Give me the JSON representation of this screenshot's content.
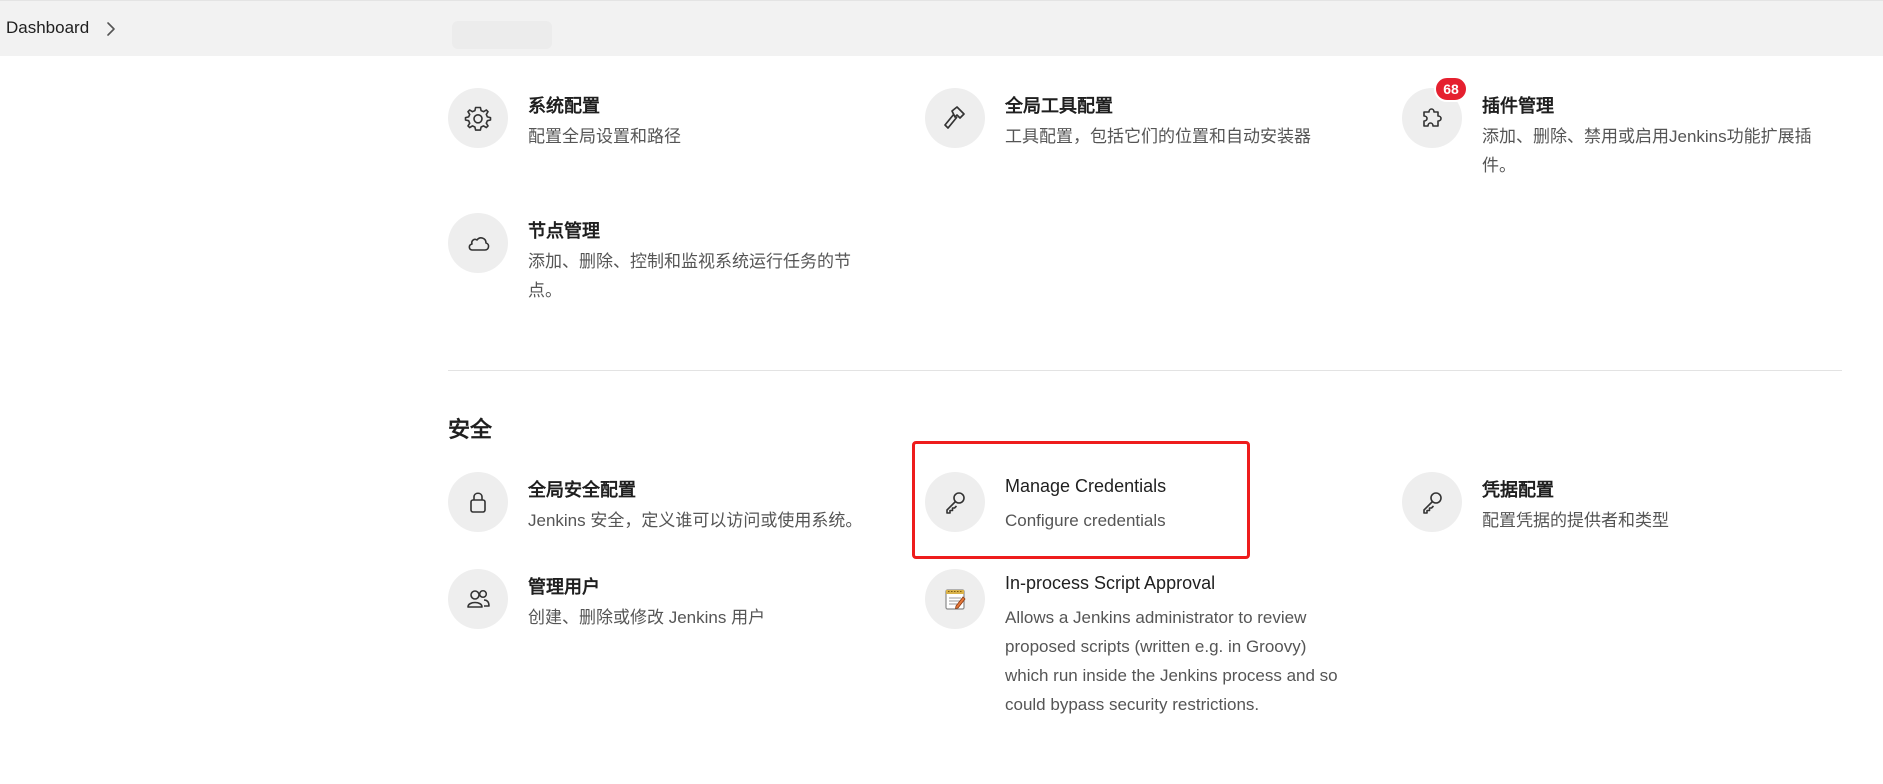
{
  "breadcrumb": {
    "dashboard": "Dashboard"
  },
  "system_items": [
    {
      "title": "系统配置",
      "desc": "配置全局设置和路径",
      "icon": "gear-icon"
    },
    {
      "title": "全局工具配置",
      "desc": "工具配置，包括它们的位置和自动安装器",
      "icon": "hammer-icon"
    },
    {
      "title": "插件管理",
      "desc": "添加、删除、禁用或启用Jenkins功能扩展插件。",
      "icon": "puzzle-icon",
      "badge": "68"
    },
    {
      "title": "节点管理",
      "desc": "添加、删除、控制和监视系统运行任务的节点。",
      "icon": "cloud-icon"
    }
  ],
  "security": {
    "title": "安全",
    "items": [
      {
        "title": "全局安全配置",
        "desc": "Jenkins 安全，定义谁可以访问或使用系统。",
        "icon": "lock-icon"
      },
      {
        "title": "Manage Credentials",
        "desc": "Configure credentials",
        "icon": "key-icon"
      },
      {
        "title": "凭据配置",
        "desc": "配置凭据的提供者和类型",
        "icon": "key-icon"
      },
      {
        "title": "管理用户",
        "desc": "创建、删除或修改 Jenkins 用户",
        "icon": "users-icon"
      },
      {
        "title": "In-process Script Approval",
        "desc": "Allows a Jenkins administrator to review proposed scripts (written e.g. in Groovy) which run inside the Jenkins process and so could bypass security restrictions.",
        "icon": "notepad-icon"
      }
    ]
  },
  "colors": {
    "badge": "#e5202f",
    "highlight": "#ee1c1c",
    "icon_bg": "#eeeeee"
  }
}
